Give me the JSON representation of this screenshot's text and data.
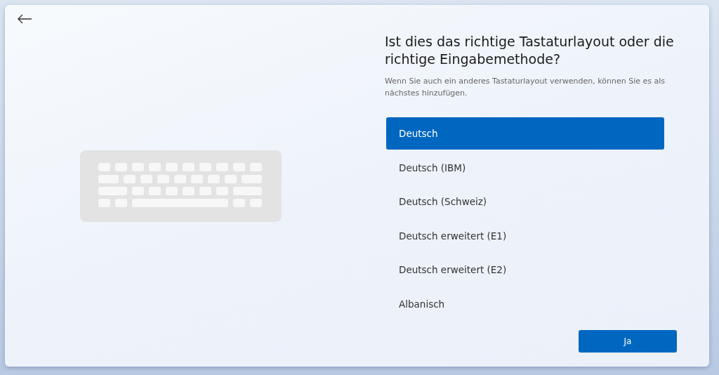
{
  "title": "Ist dies das richtige Tastaturlayout oder die richtige Eingabemethode?",
  "description": "Wenn Sie auch ein anderes Tastaturlayout verwenden, können Sie es als nächstes hinzufügen.",
  "layouts": [
    {
      "label": "Deutsch",
      "selected": true
    },
    {
      "label": "Deutsch (IBM)",
      "selected": false
    },
    {
      "label": "Deutsch (Schweiz)",
      "selected": false
    },
    {
      "label": "Deutsch erweitert (E1)",
      "selected": false
    },
    {
      "label": "Deutsch erweitert (E2)",
      "selected": false
    },
    {
      "label": "Albanisch",
      "selected": false
    }
  ],
  "confirm_button": "Ja"
}
